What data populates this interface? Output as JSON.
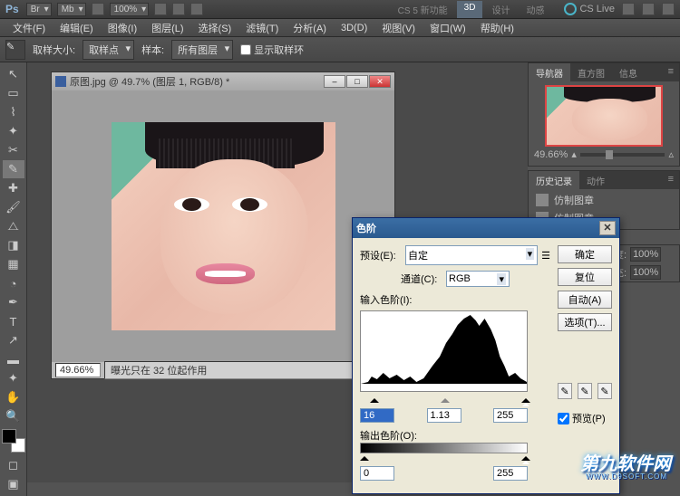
{
  "top": {
    "br": "Br",
    "mb": "Mb",
    "zoom": "100%",
    "ws": [
      "CS 5 新功能",
      "3D",
      "设计",
      "动感"
    ],
    "cslive": "CS Live"
  },
  "menu": [
    "文件(F)",
    "编辑(E)",
    "图像(I)",
    "图层(L)",
    "选择(S)",
    "滤镜(T)",
    "分析(A)",
    "3D(D)",
    "视图(V)",
    "窗口(W)",
    "帮助(H)"
  ],
  "opt": {
    "label1": "取样大小:",
    "val1": "取样点",
    "label2": "样本:",
    "val2": "所有图层",
    "chk": "显示取样环"
  },
  "doc": {
    "title": "原图.jpg @ 49.7% (图层 1, RGB/8) *",
    "zoom": "49.66%",
    "info": "曝光只在 32 位起作用"
  },
  "nav": {
    "tabs": [
      "导航器",
      "直方图",
      "信息"
    ],
    "zoom": "49.66%"
  },
  "hist": {
    "tabs": [
      "历史记录",
      "动作"
    ],
    "items": [
      "仿制图章",
      "仿制图章"
    ]
  },
  "dlg": {
    "title": "色阶",
    "preset_l": "预设(E):",
    "preset_v": "自定",
    "channel_l": "通道(C):",
    "channel_v": "RGB",
    "input_l": "输入色阶(I):",
    "in_black": "16",
    "in_gamma": "1.13",
    "in_white": "255",
    "output_l": "输出色阶(O):",
    "out_black": "0",
    "out_white": "255",
    "btn_ok": "确定",
    "btn_cancel": "复位",
    "btn_auto": "自动(A)",
    "btn_opt": "选项(T)...",
    "preview": "预览(P)"
  },
  "layers": {
    "opacity_l": "度:",
    "opacity": "100%",
    "fill_l": "充:",
    "fill": "100%"
  },
  "watermark": {
    "main": "第九软件网",
    "sub": "WWW.D9SOFT.COM"
  }
}
